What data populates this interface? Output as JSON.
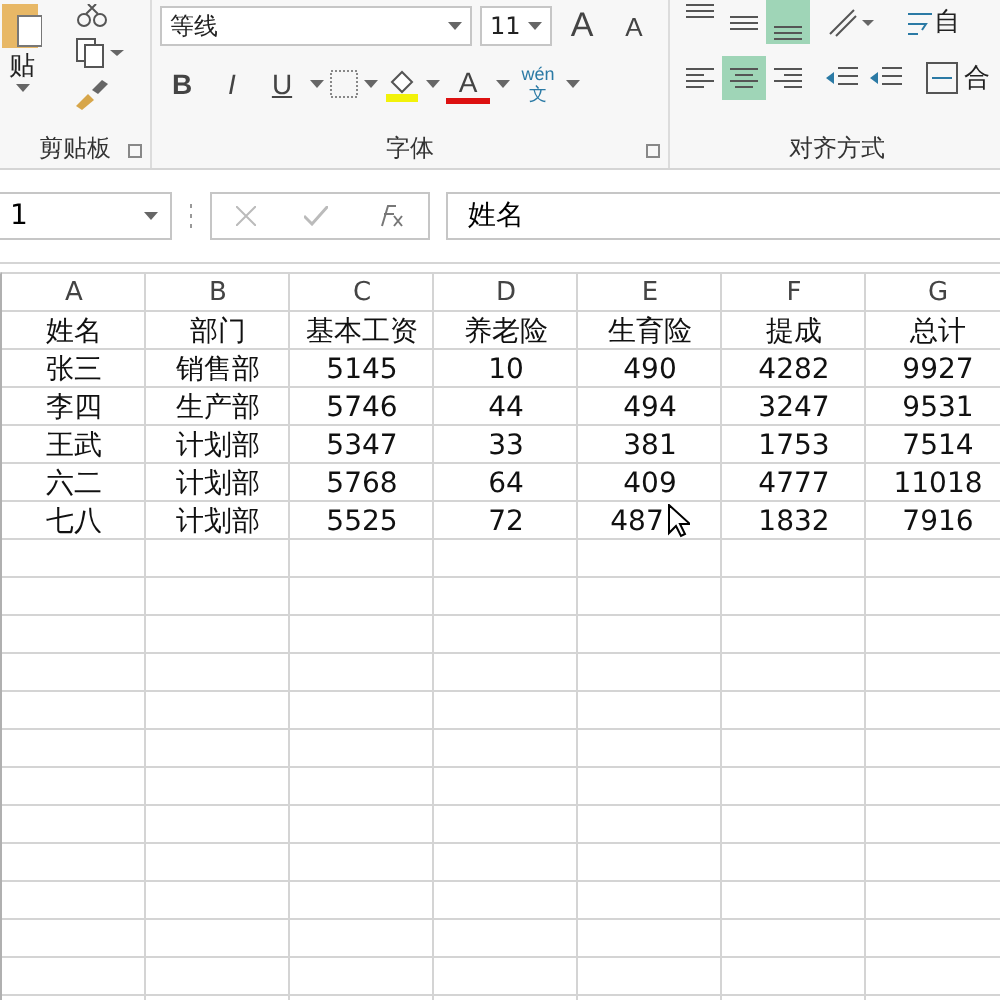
{
  "ribbon": {
    "clipboard": {
      "paste_label": "贴",
      "group_label": "剪贴板"
    },
    "font": {
      "font_name": "等线",
      "font_size": "11",
      "grow_label": "A",
      "shrink_label": "A",
      "bold_label": "B",
      "italic_label": "I",
      "underline_label": "U",
      "font_color_label": "A",
      "phonetic_top": "wén",
      "phonetic_bottom": "文",
      "group_label": "字体"
    },
    "alignment": {
      "vertical": [
        {
          "kind": "top",
          "selected": false
        },
        {
          "kind": "middle",
          "selected": false
        },
        {
          "kind": "bottom",
          "selected": true
        }
      ],
      "horizontal": [
        {
          "kind": "left",
          "selected": false
        },
        {
          "kind": "center",
          "selected": true
        },
        {
          "kind": "right",
          "selected": false
        }
      ],
      "group_label": "对齐方式",
      "wrap_label": "自",
      "merge_label": "合"
    }
  },
  "formula_bar": {
    "name_box": "1",
    "formula": "姓名"
  },
  "sheet": {
    "columns": [
      "A",
      "B",
      "C",
      "D",
      "E",
      "F",
      "G"
    ],
    "rows": [
      [
        "姓名",
        "部门",
        "基本工资",
        "养老险",
        "生育险",
        "提成",
        "总计"
      ],
      [
        "张三",
        "销售部",
        "5145",
        "10",
        "490",
        "4282",
        "9927"
      ],
      [
        "李四",
        "生产部",
        "5746",
        "44",
        "494",
        "3247",
        "9531"
      ],
      [
        "王武",
        "计划部",
        "5347",
        "33",
        "381",
        "1753",
        "7514"
      ],
      [
        "六二",
        "计划部",
        "5768",
        "64",
        "409",
        "4777",
        "11018"
      ],
      [
        "七八",
        "计划部",
        "5525",
        "72",
        "487",
        "1832",
        "7916"
      ]
    ]
  }
}
